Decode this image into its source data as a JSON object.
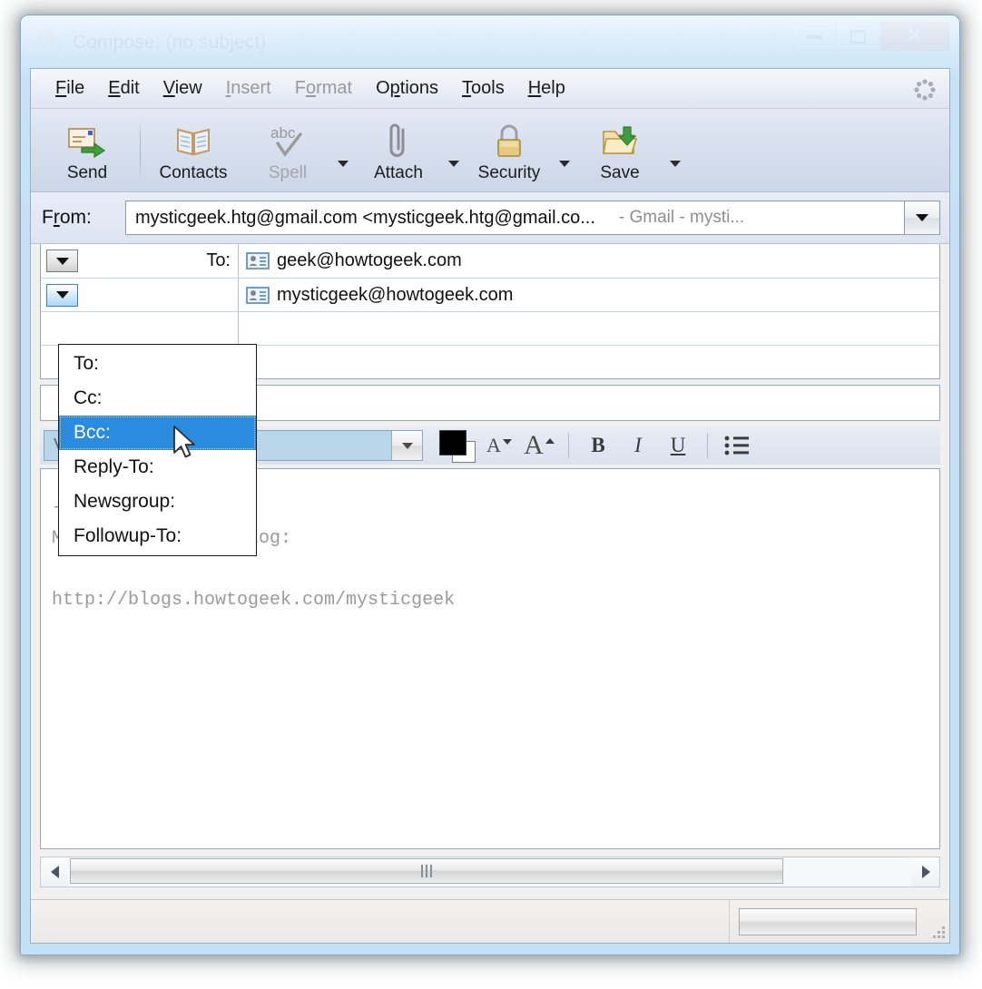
{
  "window": {
    "title": "Compose: (no subject)",
    "icon": "compose-mail-icon",
    "controls": {
      "minimize": "Minimize",
      "restore": "Restore",
      "close": "Close"
    }
  },
  "menubar": {
    "items": [
      {
        "label": "File",
        "accel": "F",
        "disabled": false
      },
      {
        "label": "Edit",
        "accel": "E",
        "disabled": false
      },
      {
        "label": "View",
        "accel": "V",
        "disabled": false
      },
      {
        "label": "Insert",
        "accel": "I",
        "disabled": true
      },
      {
        "label": "Format",
        "accel": "o",
        "disabled": true
      },
      {
        "label": "Options",
        "accel": "p",
        "disabled": false
      },
      {
        "label": "Tools",
        "accel": "T",
        "disabled": false
      },
      {
        "label": "Help",
        "accel": "H",
        "disabled": false
      }
    ],
    "throbber": "activity-throbber-icon"
  },
  "toolbar": {
    "buttons": [
      {
        "label": "Send",
        "icon": "send-icon",
        "disabled": false,
        "dropdown": false
      },
      {
        "label": "Contacts",
        "icon": "contacts-book-icon",
        "disabled": false,
        "dropdown": false
      },
      {
        "label": "Spell",
        "icon": "spellcheck-icon",
        "disabled": true,
        "dropdown": true
      },
      {
        "label": "Attach",
        "icon": "paperclip-icon",
        "disabled": false,
        "dropdown": true
      },
      {
        "label": "Security",
        "icon": "padlock-icon",
        "disabled": false,
        "dropdown": true
      },
      {
        "label": "Save",
        "icon": "save-folder-icon",
        "disabled": false,
        "dropdown": true
      }
    ]
  },
  "from": {
    "label": "From:",
    "value": "mysticgeek.htg@gmail.com <mysticgeek.htg@gmail.co...",
    "account": "- Gmail - mysti...",
    "dropdown_icon": "chevron-down-icon"
  },
  "recipients": {
    "rows": [
      {
        "type": "To:",
        "value": "geek@howtogeek.com",
        "icon": "contact-card-icon",
        "button_active": false
      },
      {
        "type": "",
        "value": "mysticgeek@howtogeek.com",
        "icon": "contact-card-icon",
        "button_active": true
      },
      {
        "type": "",
        "value": "",
        "icon": "",
        "button_active": false
      },
      {
        "type": "",
        "value": "",
        "icon": "",
        "button_active": false
      }
    ]
  },
  "subject": {
    "value": "",
    "placeholder": ""
  },
  "format_toolbar": {
    "font": "Variable Width",
    "font_dropdown_icon": "chevron-down-icon",
    "color_foreground": "#000000",
    "color_background": "#ffffff",
    "buttons": [
      {
        "name": "decrease-font-size",
        "label": "A"
      },
      {
        "name": "increase-font-size",
        "label": "A"
      },
      {
        "name": "bold",
        "label": "B"
      },
      {
        "name": "italic",
        "label": "I"
      },
      {
        "name": "underline",
        "label": "U"
      },
      {
        "name": "bullet-list",
        "label": ""
      }
    ]
  },
  "body": {
    "text": "--\nMy Computer Tech Blog:\n\nhttp://blogs.howtogeek.com/mysticgeek"
  },
  "popup_menu": {
    "items": [
      {
        "label": "To:",
        "selected": false
      },
      {
        "label": "Cc:",
        "selected": false
      },
      {
        "label": "Bcc:",
        "selected": true
      },
      {
        "label": "Reply-To:",
        "selected": false
      },
      {
        "label": "Newsgroup:",
        "selected": false
      },
      {
        "label": "Followup-To:",
        "selected": false
      }
    ],
    "highlight_color": "#2a8bdf"
  },
  "scrollbar": {
    "left_arrow": "arrow-left-icon",
    "right_arrow": "arrow-right-icon",
    "grip": "scrollbar-grip"
  },
  "statusbar": {
    "message": "",
    "meter_value": "",
    "resize_grip": "resize-grip-icon"
  }
}
